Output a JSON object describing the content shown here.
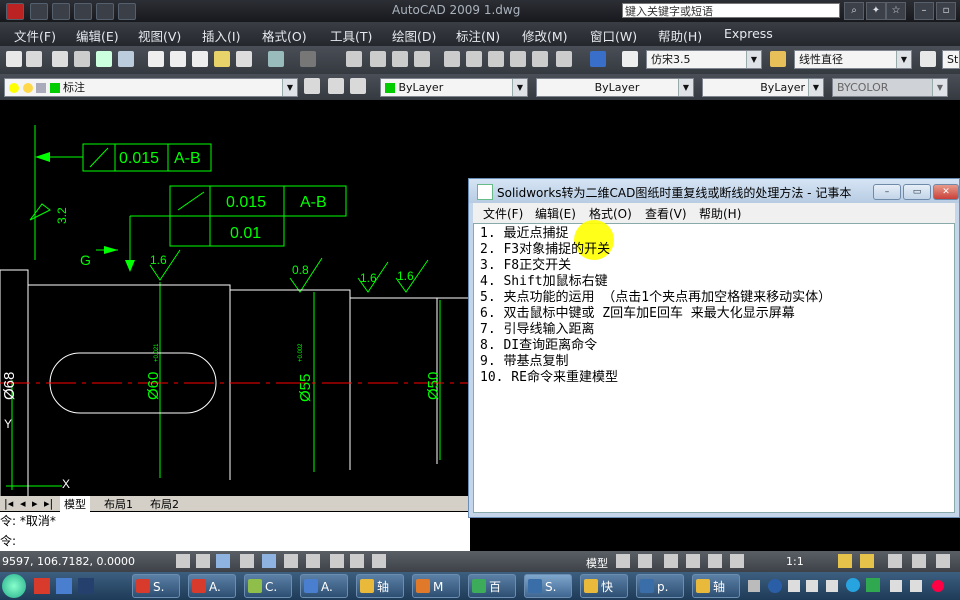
{
  "app": {
    "title": "AutoCAD 2009  1.dwg",
    "search_placeholder": "键入关键字或短语"
  },
  "menubar": [
    "文件(F)",
    "编辑(E)",
    "视图(V)",
    "插入(I)",
    "格式(O)",
    "工具(T)",
    "绘图(D)",
    "标注(N)",
    "修改(M)",
    "窗口(W)",
    "帮助(H)",
    "Express"
  ],
  "toolbar": {
    "font_combo": "仿宋3.5",
    "dim_combo": "线性直径",
    "std_label": "Sta",
    "layer_combo": "标注",
    "color_combo": "ByLayer",
    "linetype_combo": "ByLayer",
    "lineweight_combo": "ByLayer",
    "plotstyle_combo": "BYCOLOR"
  },
  "drawing": {
    "fcf1": {
      "tol": "0.015",
      "datum": "A-B"
    },
    "fcf2": {
      "tol": "0.015",
      "datum": "A-B",
      "tol2": "0.01"
    },
    "datum_label": "G",
    "roughness": [
      "1.6",
      "0.8",
      "1.6",
      "1.6"
    ],
    "roughness_left": "3.2",
    "dims": {
      "d68": "Ø68",
      "d60": "Ø60",
      "d55": "Ø55",
      "d50": "Ø50"
    },
    "tol_small": [
      "+0.021",
      "+0.002"
    ],
    "ucs_x": "X",
    "ucs_y": "Y"
  },
  "tabs": [
    "模型",
    "布局1",
    "布局2"
  ],
  "command": {
    "line1": "令: *取消*",
    "line2": "令:"
  },
  "status": {
    "coords": "9597,  106.7182,  0.0000",
    "model_label": "模型",
    "scale": "1:1"
  },
  "notepad": {
    "title": "Solidworks转为二维CAD图纸时重复线或断线的处理方法 - 记事本",
    "menu": [
      "文件(F)",
      "编辑(E)",
      "格式(O)",
      "查看(V)",
      "帮助(H)"
    ],
    "lines": [
      "1. 最近点捕捉",
      "2. F3对象捕捉的开关",
      "3. F8正交开关",
      "4. Shift加鼠标右键",
      "5. 夹点功能的运用 （点击1个夹点再加空格键来移动实体）",
      "6. 双击鼠标中键或 Z回车加E回车 来最大化显示屏幕",
      "7. 引导线输入距离",
      "8. DI查询距离命令",
      "9. 带基点复制",
      "10. RE命令来重建模型"
    ]
  },
  "taskbar": {
    "items": [
      "S.",
      "A.",
      "C.",
      "A.",
      "轴",
      "M",
      "百",
      "S.",
      "快",
      "p.",
      "轴"
    ],
    "icon_colors": [
      "#d83a2b",
      "#d83a2b",
      "#8fbf4a",
      "#4a7fd0",
      "#e8b93a",
      "#e07a2a",
      "#3cab5a",
      "#3a6ea8",
      "#e8b93a",
      "#3a6ea8",
      "#e8b93a"
    ]
  },
  "colors": {
    "cad_green": "#00ff00",
    "cad_white": "#ffffff",
    "cad_red": "#ff0000",
    "highlight": "#ffff00"
  }
}
